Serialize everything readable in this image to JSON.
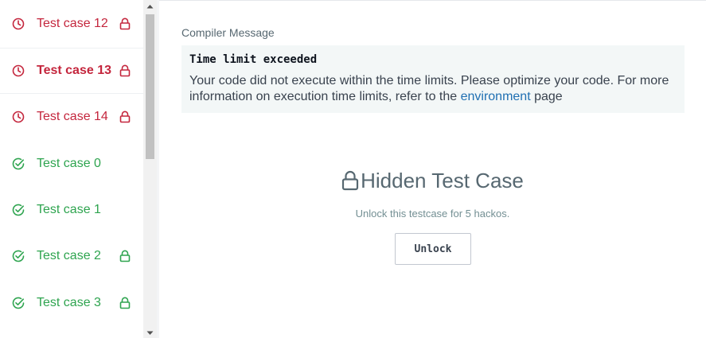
{
  "colors": {
    "fail": "#c4263d",
    "pass": "#2ea44f",
    "link": "#1f6fb2"
  },
  "sidebar": {
    "items": [
      {
        "label": "Test case 12",
        "status": "fail",
        "status_icon": "clock-icon",
        "locked": true
      },
      {
        "label": "Test case 13",
        "status": "fail",
        "status_icon": "clock-icon",
        "locked": true,
        "active": true
      },
      {
        "label": "Test case 14",
        "status": "fail",
        "status_icon": "clock-icon",
        "locked": true
      },
      {
        "label": "Test case 0",
        "status": "pass",
        "status_icon": "check-circle-icon",
        "locked": false
      },
      {
        "label": "Test case 1",
        "status": "pass",
        "status_icon": "check-circle-icon",
        "locked": false
      },
      {
        "label": "Test case 2",
        "status": "pass",
        "status_icon": "check-circle-icon",
        "locked": true
      },
      {
        "label": "Test case 3",
        "status": "pass",
        "status_icon": "check-circle-icon",
        "locked": true
      }
    ]
  },
  "main": {
    "compiler_label": "Compiler Message",
    "compiler_title": "Time limit exceeded",
    "compiler_text_before": "Your code did not execute within the time limits. Please optimize your code. For more information on execution time limits, refer to the ",
    "compiler_link": "environment",
    "compiler_text_after": " page",
    "hidden_title": "Hidden Test Case",
    "hidden_sub": "Unlock this testcase for 5 hackos.",
    "unlock_label": "Unlock"
  }
}
